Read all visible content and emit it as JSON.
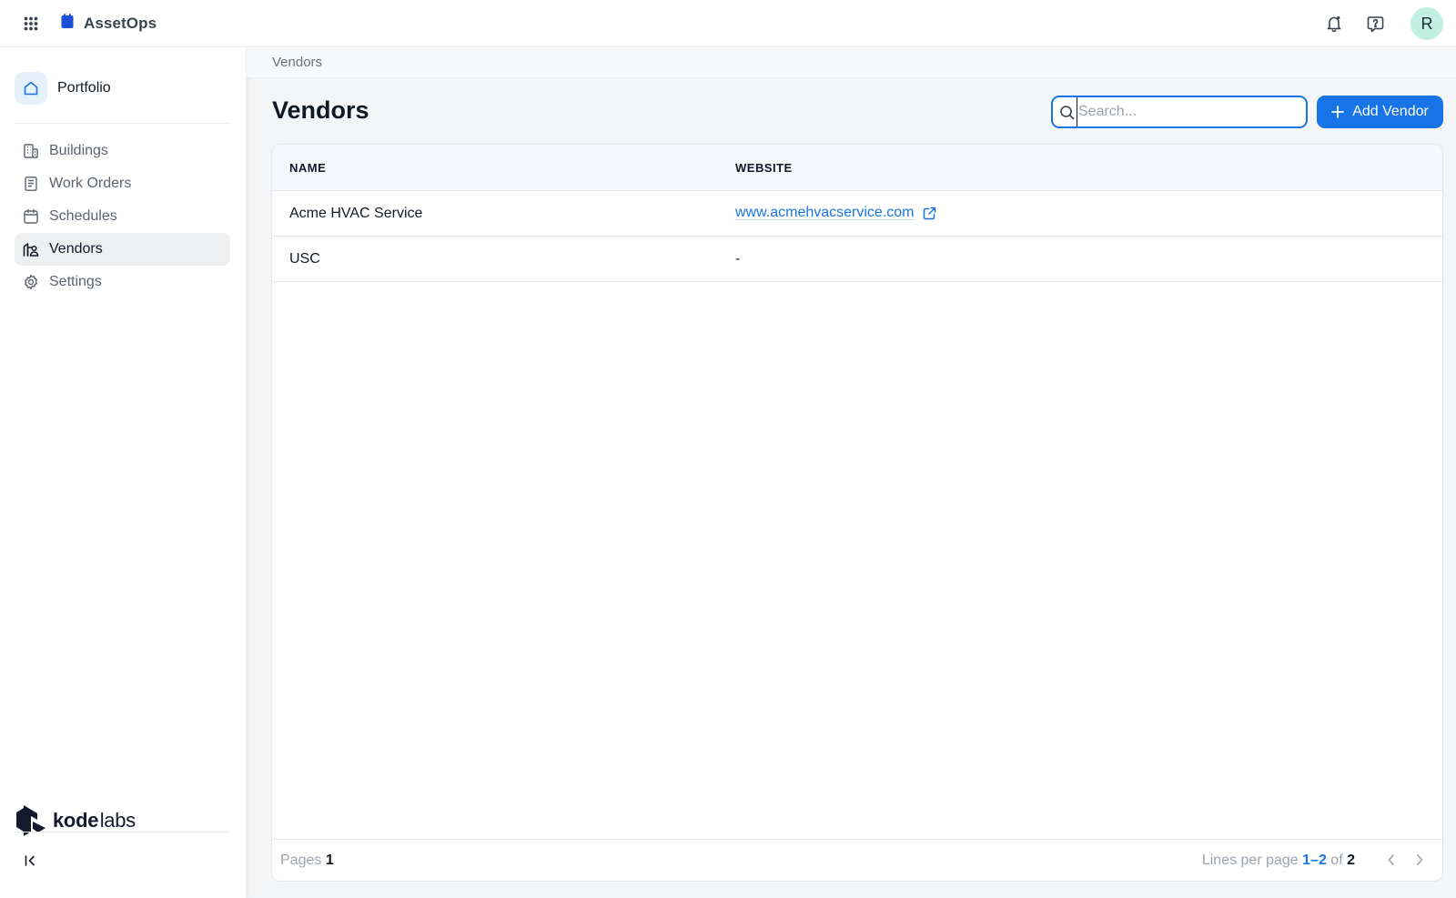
{
  "app": {
    "name": "AssetOps",
    "user_initial": "R",
    "accent_color": "#1774e6",
    "icons": [
      "apps-grid-icon",
      "app-logo-icon",
      "bell-icon",
      "help-icon"
    ]
  },
  "sidebar": {
    "portfolio_label": "Portfolio",
    "items": [
      {
        "label": "Buildings",
        "icon": "building-icon",
        "active": false
      },
      {
        "label": "Work Orders",
        "icon": "clipboard-icon",
        "active": false
      },
      {
        "label": "Schedules",
        "icon": "calendar-icon",
        "active": false
      },
      {
        "label": "Vendors",
        "icon": "vendor-icon",
        "active": true
      },
      {
        "label": "Settings",
        "icon": "gear-icon",
        "active": false
      }
    ],
    "footer_logo": {
      "part1": "kode",
      "part2": "labs"
    }
  },
  "breadcrumb": "Vendors",
  "page": {
    "title": "Vendors",
    "search": {
      "placeholder": "Search...",
      "value": ""
    },
    "add_button_label": "Add Vendor"
  },
  "table": {
    "columns": [
      "NAME",
      "WEBSITE"
    ],
    "rows": [
      {
        "name": "Acme HVAC Service",
        "website": "www.acmehvacservice.com",
        "website_is_link": true
      },
      {
        "name": "USC",
        "website": "-",
        "website_is_link": false
      }
    ],
    "footer": {
      "pages_label": "Pages",
      "pages_value": "1",
      "lines_label": "Lines per page",
      "range": "1–2",
      "of_label": "of",
      "total": "2"
    }
  }
}
